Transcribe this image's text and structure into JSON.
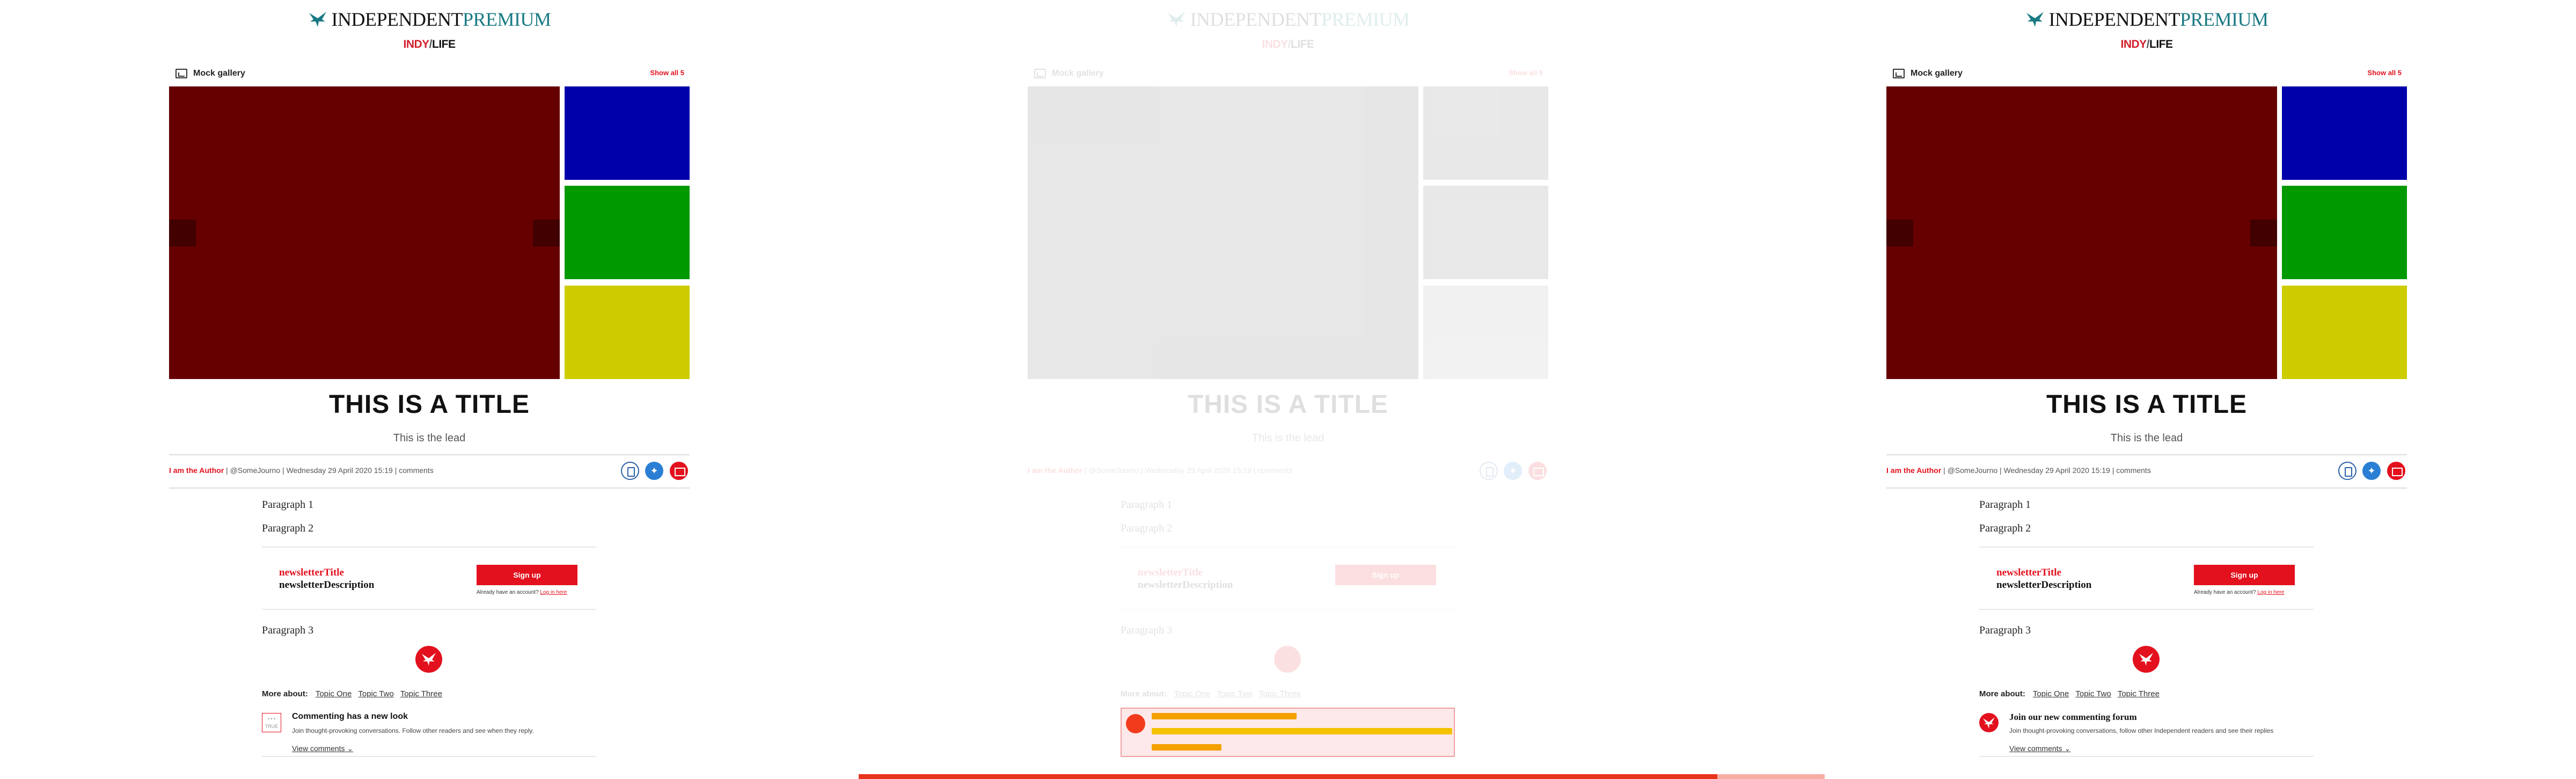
{
  "brand": {
    "name": "INDEPENDENT",
    "tier": "PREMIUM",
    "section_a": "INDY",
    "section_sep": "/",
    "section_b": "LIFE"
  },
  "gallery": {
    "title": "Mock gallery",
    "show_all": "Show all 5",
    "colors": {
      "main": "#660000",
      "thumb1": "#0000aa",
      "thumb2": "#009900",
      "thumb3": "#cccc00"
    }
  },
  "article": {
    "title": "THIS IS A TITLE",
    "lead": "This is the lead",
    "author": "I am the Author",
    "handle": "@SomeJourno",
    "date": "Wednesday 29 April 2020 15:19",
    "comments": "comments",
    "paragraphs": [
      "Paragraph 1",
      "Paragraph 2",
      "Paragraph 3"
    ]
  },
  "newsletter": {
    "title": "newsletterTitle",
    "description": "newsletterDescription",
    "button": "Sign up",
    "login_prefix": "Already have an account?",
    "login_link": "Log in here"
  },
  "more_about": {
    "label": "More about:",
    "topics": [
      "Topic One",
      "Topic Two",
      "Topic Three"
    ]
  },
  "commenting": {
    "a": {
      "title": "Commenting has a new look",
      "description": "Join thought-provoking conversations. Follow other readers and see when they reply.",
      "icon_text": "• • •\nTRUE",
      "view": "View comments"
    },
    "b": {
      "title": "Join our new commenting forum",
      "description": "Join thought-provoking conversations, follow other Independent readers and see their replies",
      "view": "View comments"
    }
  },
  "icons": [
    "independent-eagle-icon",
    "gallery-icon",
    "arrow-left-icon",
    "arrow-right-icon",
    "bookmark-icon",
    "twitter-icon",
    "email-icon",
    "independent-badge-icon",
    "chevron-down-icon"
  ],
  "accent": "#e3101d"
}
